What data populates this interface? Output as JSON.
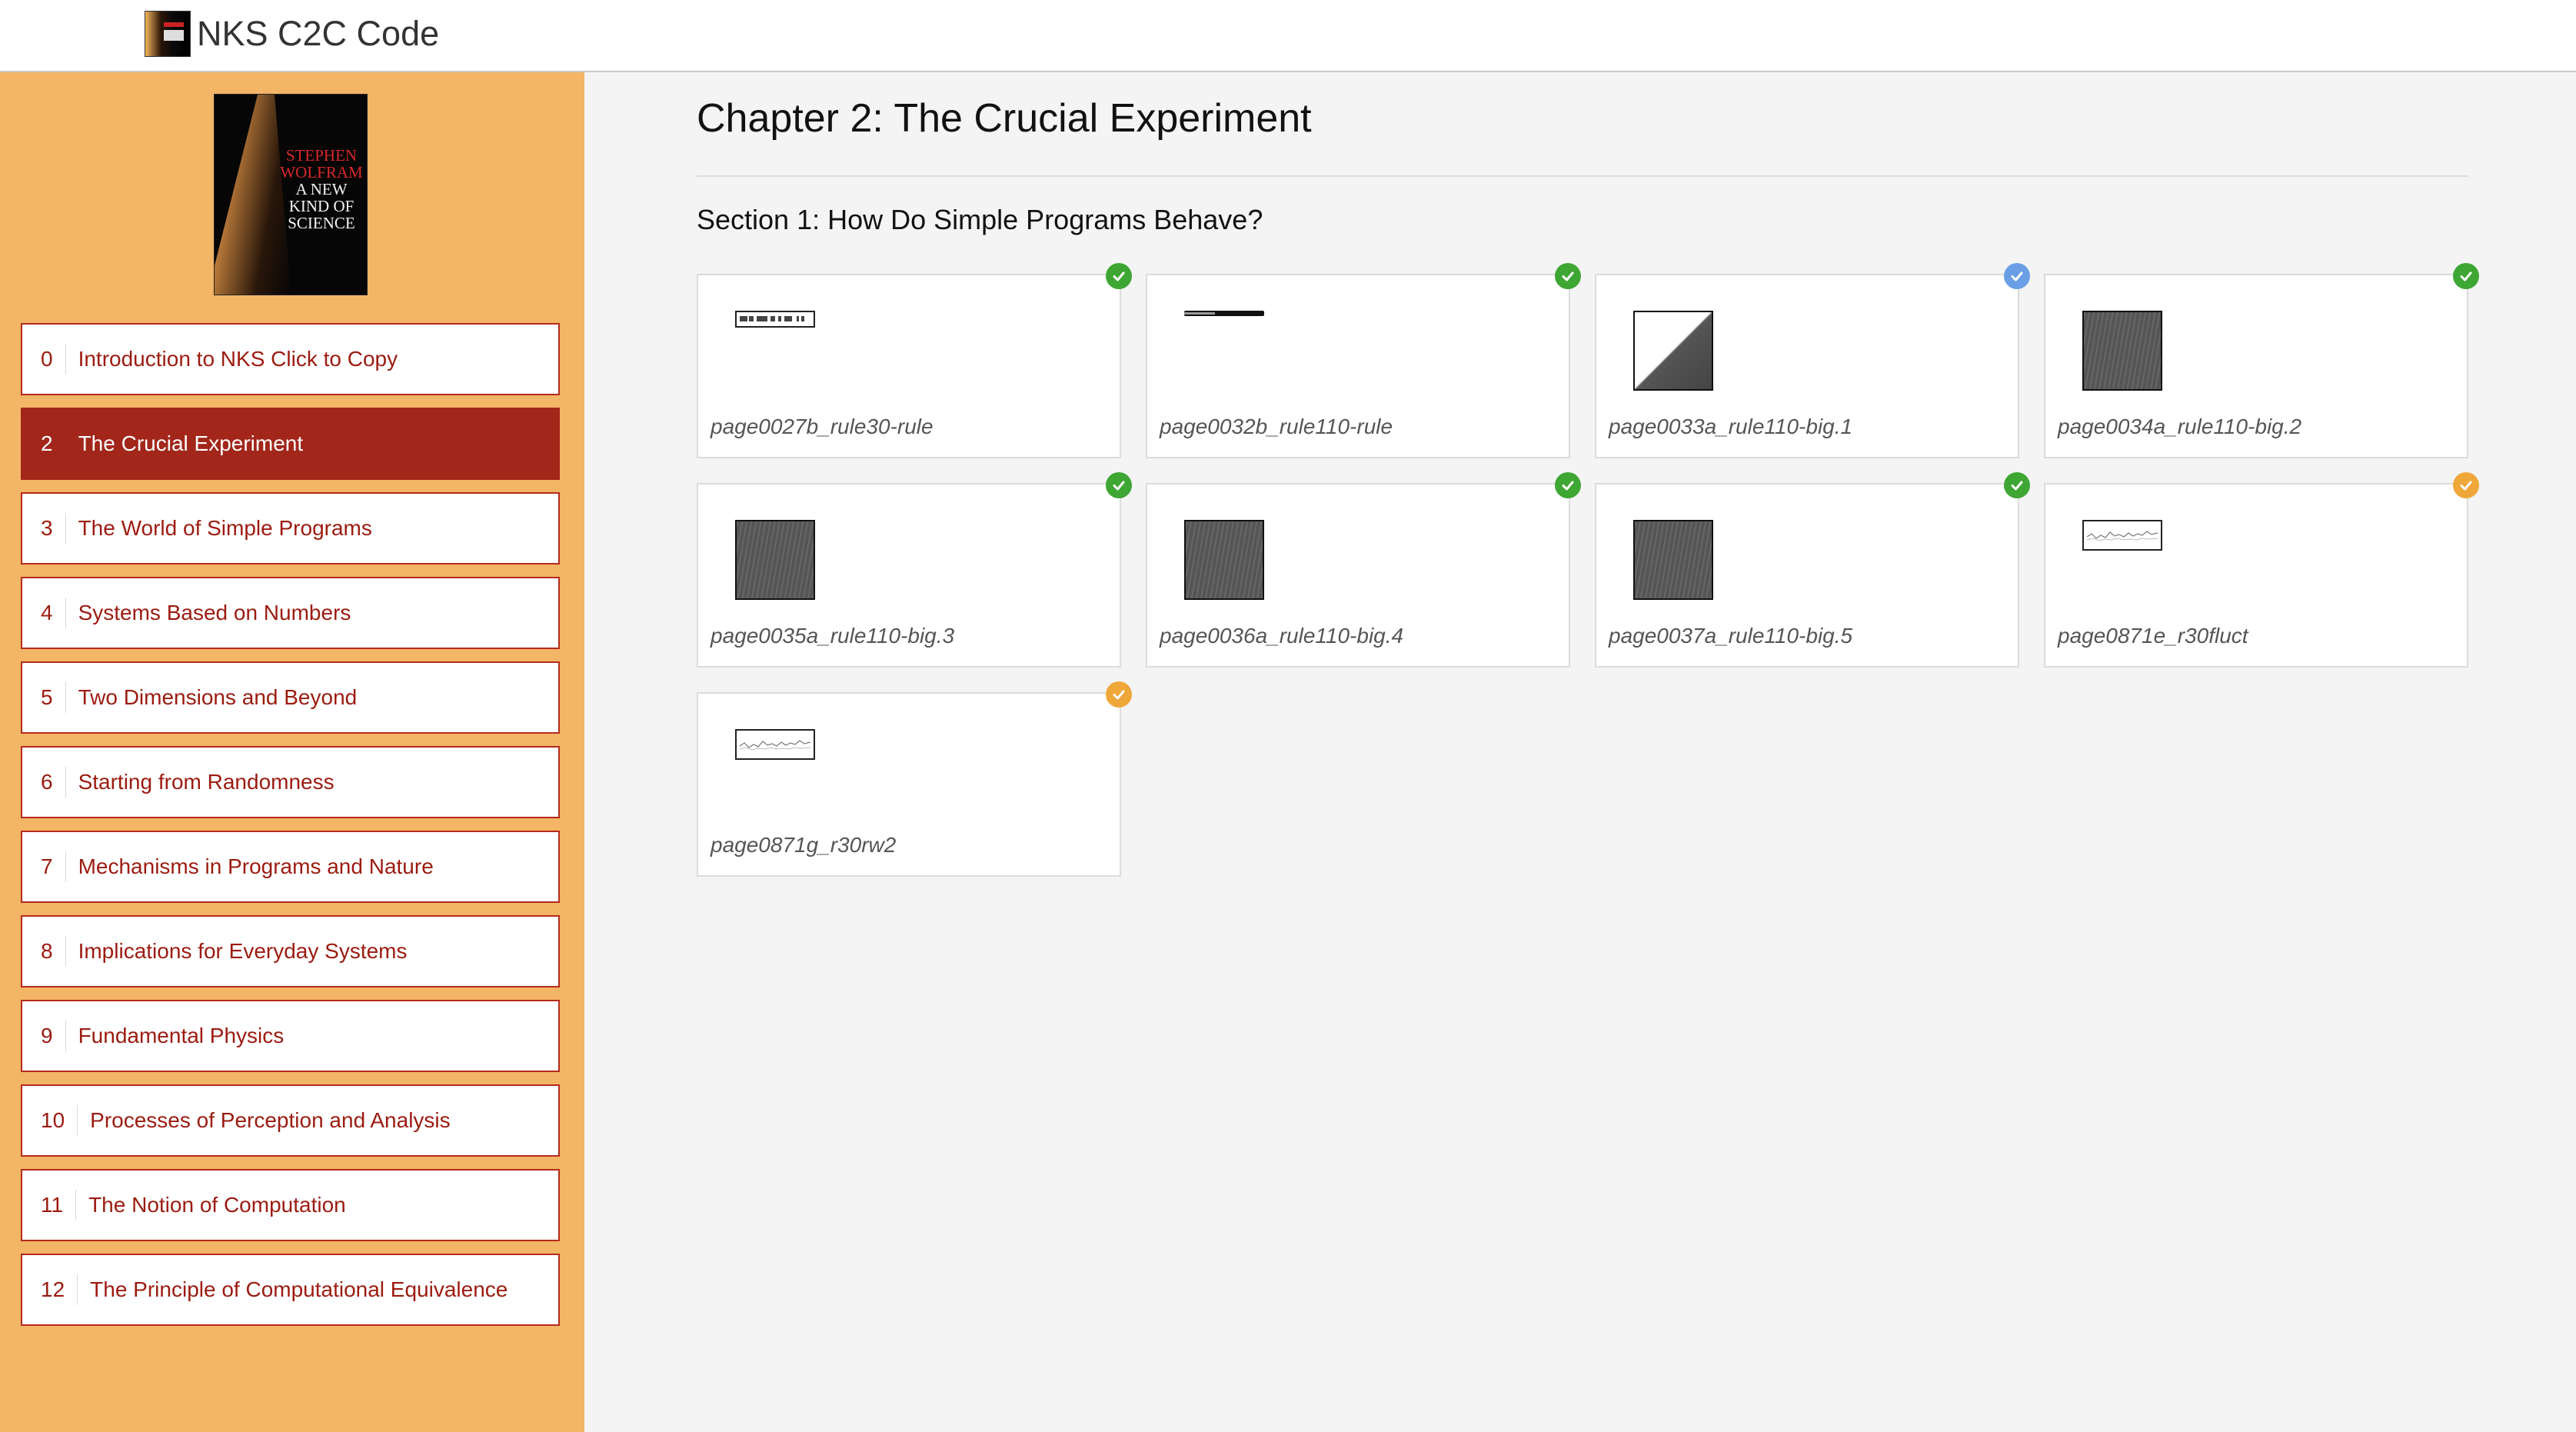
{
  "header": {
    "title": "NKS C2C Code"
  },
  "book_cover": {
    "author_line1": "STEPHEN",
    "author_line2": "WOLFRAM",
    "title_line1": "A NEW",
    "title_line2": "KIND OF",
    "title_line3": "SCIENCE"
  },
  "sidebar": {
    "chapters": [
      {
        "num": "0",
        "label": "Introduction to NKS Click to Copy",
        "active": false
      },
      {
        "num": "2",
        "label": "The Crucial Experiment",
        "active": true
      },
      {
        "num": "3",
        "label": "The World of Simple Programs",
        "active": false
      },
      {
        "num": "4",
        "label": "Systems Based on Numbers",
        "active": false
      },
      {
        "num": "5",
        "label": "Two Dimensions and Beyond",
        "active": false
      },
      {
        "num": "6",
        "label": "Starting from Randomness",
        "active": false
      },
      {
        "num": "7",
        "label": "Mechanisms in Programs and Nature",
        "active": false
      },
      {
        "num": "8",
        "label": "Implications for Everyday Systems",
        "active": false
      },
      {
        "num": "9",
        "label": "Fundamental Physics",
        "active": false
      },
      {
        "num": "10",
        "label": "Processes of Perception and Analysis",
        "active": false
      },
      {
        "num": "11",
        "label": "The Notion of Computation",
        "active": false
      },
      {
        "num": "12",
        "label": "The Principle of Computational Equivalence",
        "active": false
      }
    ]
  },
  "main": {
    "chapter_title": "Chapter 2: The Crucial Experiment",
    "section_title": "Section 1: How Do Simple Programs Behave?",
    "cards": [
      {
        "caption": "page0027b_rule30-rule",
        "status": "green",
        "thumb": "strip-pattern"
      },
      {
        "caption": "page0032b_rule110-rule",
        "status": "green",
        "thumb": "line"
      },
      {
        "caption": "page0033a_rule110-big.1",
        "status": "blue",
        "thumb": "triangle"
      },
      {
        "caption": "page0034a_rule110-big.2",
        "status": "green",
        "thumb": "dark"
      },
      {
        "caption": "page0035a_rule110-big.3",
        "status": "green",
        "thumb": "dark"
      },
      {
        "caption": "page0036a_rule110-big.4",
        "status": "green",
        "thumb": "dark"
      },
      {
        "caption": "page0037a_rule110-big.5",
        "status": "green",
        "thumb": "dark"
      },
      {
        "caption": "page0871e_r30fluct",
        "status": "orange",
        "thumb": "fluct"
      },
      {
        "caption": "page0871g_r30rw2",
        "status": "orange",
        "thumb": "fluct"
      }
    ]
  },
  "colors": {
    "sidebar_bg": "#f3b566",
    "accent_red": "#a2261a",
    "status_green": "#3ea633",
    "status_blue": "#6a9fe6",
    "status_orange": "#efa73a"
  }
}
